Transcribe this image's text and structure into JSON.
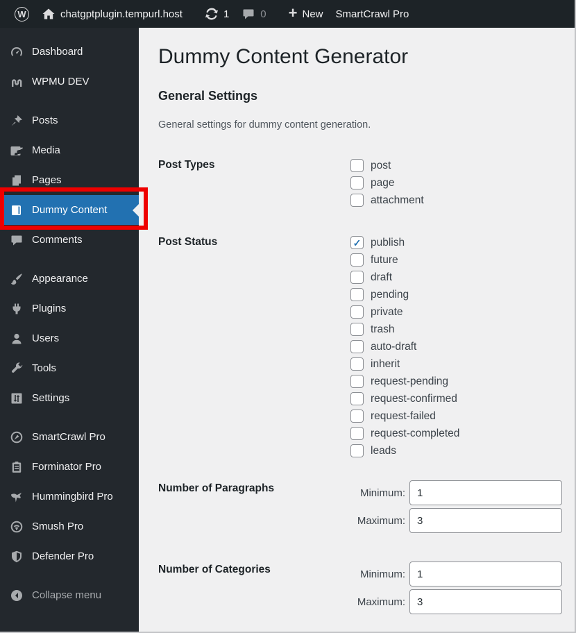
{
  "admin_bar": {
    "wp_logo_letter": "W",
    "site_name": "chatgptplugin.tempurl.host",
    "updates_count": "1",
    "comments_count": "0",
    "new_label": "New",
    "smartcrawl_label": "SmartCrawl Pro"
  },
  "sidebar": {
    "groups": [
      {
        "items": [
          {
            "label": "Dashboard",
            "icon": "dashboard-icon"
          },
          {
            "label": "WPMU DEV",
            "icon": "wpmu-dev-icon"
          }
        ]
      },
      {
        "items": [
          {
            "label": "Posts",
            "icon": "pushpin-icon"
          },
          {
            "label": "Media",
            "icon": "media-icon"
          },
          {
            "label": "Pages",
            "icon": "pages-icon"
          },
          {
            "label": "Dummy Content",
            "icon": "book-icon",
            "active": true,
            "annotated": true
          },
          {
            "label": "Comments",
            "icon": "comment-icon"
          }
        ]
      },
      {
        "items": [
          {
            "label": "Appearance",
            "icon": "brush-icon"
          },
          {
            "label": "Plugins",
            "icon": "plug-icon"
          },
          {
            "label": "Users",
            "icon": "user-icon"
          },
          {
            "label": "Tools",
            "icon": "wrench-icon"
          },
          {
            "label": "Settings",
            "icon": "sliders-icon"
          }
        ]
      },
      {
        "items": [
          {
            "label": "SmartCrawl Pro",
            "icon": "smartcrawl-icon"
          },
          {
            "label": "Forminator Pro",
            "icon": "clipboard-icon"
          },
          {
            "label": "Hummingbird Pro",
            "icon": "hummingbird-icon"
          },
          {
            "label": "Smush Pro",
            "icon": "smush-icon"
          },
          {
            "label": "Defender Pro",
            "icon": "shield-icon"
          }
        ]
      },
      {
        "items": [
          {
            "label": "Collapse menu",
            "icon": "collapse-icon",
            "muted": true
          }
        ]
      }
    ]
  },
  "annotation": {
    "shape": "red-rectangle",
    "target": "Dummy Content",
    "color": "#ee0000"
  },
  "main": {
    "title": "Dummy Content Generator",
    "section_title": "General Settings",
    "section_description": "General settings for dummy content generation.",
    "fields": [
      {
        "label": "Post Types",
        "type": "checkboxes",
        "options": [
          {
            "label": "post",
            "checked": false
          },
          {
            "label": "page",
            "checked": false
          },
          {
            "label": "attachment",
            "checked": false
          }
        ]
      },
      {
        "label": "Post Status",
        "type": "checkboxes",
        "options": [
          {
            "label": "publish",
            "checked": true
          },
          {
            "label": "future",
            "checked": false
          },
          {
            "label": "draft",
            "checked": false
          },
          {
            "label": "pending",
            "checked": false
          },
          {
            "label": "private",
            "checked": false
          },
          {
            "label": "trash",
            "checked": false
          },
          {
            "label": "auto-draft",
            "checked": false
          },
          {
            "label": "inherit",
            "checked": false
          },
          {
            "label": "request-pending",
            "checked": false
          },
          {
            "label": "request-confirmed",
            "checked": false
          },
          {
            "label": "request-failed",
            "checked": false
          },
          {
            "label": "request-completed",
            "checked": false
          },
          {
            "label": "leads",
            "checked": false
          }
        ]
      },
      {
        "label": "Number of Paragraphs",
        "type": "minmax",
        "min_label": "Minimum:",
        "max_label": "Maximum:",
        "min_value": "1",
        "max_value": "3"
      },
      {
        "label": "Number of Categories",
        "type": "minmax",
        "min_label": "Minimum:",
        "max_label": "Maximum:",
        "min_value": "1",
        "max_value": "3"
      }
    ]
  },
  "colors": {
    "admin_bar_bg": "#1d2327",
    "sidebar_bg": "#23282d",
    "active_item_bg": "#2271b1",
    "content_bg": "#f0f0f1",
    "annotation_red": "#ee0000",
    "check_blue": "#2271b1"
  }
}
